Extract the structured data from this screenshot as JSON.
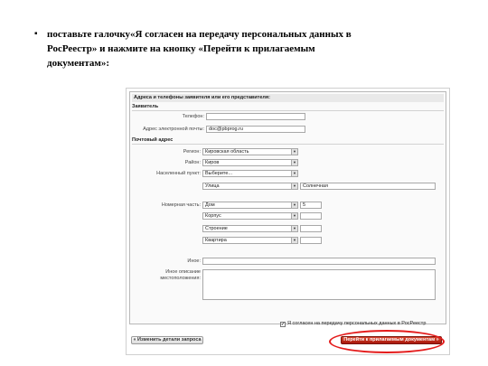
{
  "instruction": {
    "bullet": "▪",
    "text": "поставьте галочку«Я согласен на передачу персональных данных в РосРеестр» и нажмите на кнопку «Перейти к прилагаемым документам»:"
  },
  "form": {
    "panel_title": "Адреса и телефоны заявителя или его представителя:",
    "applicant_section": "Заявитель",
    "phone_label": "Телефон:",
    "phone_value": "",
    "email_label": "Адрес электронной почты:",
    "email_value": "doc@pbprog.ru",
    "postal_section": "Почтовый адрес",
    "region_label": "Регион:",
    "region_value": "Кировская область",
    "district_label": "Район:",
    "district_value": "Киров",
    "locality_label": "Населенный пункт:",
    "locality_value": "Выберите...",
    "street_type_value": "Улица",
    "street_name_value": "Солнечная",
    "number_label": "Номерная часть:",
    "number_rows": [
      {
        "type": "Дом",
        "value": "5"
      },
      {
        "type": "Корпус",
        "value": ""
      },
      {
        "type": "Строение",
        "value": ""
      },
      {
        "type": "Квартира",
        "value": ""
      }
    ],
    "other_label": "Иное:",
    "other_value": "",
    "location_label": "Иное описание местоположения:",
    "location_value": "",
    "consent_label": "Я согласен на передачу персональных данных в РосРеестр",
    "consent_checked": "✔",
    "back_button": "« Изменить детали запроса",
    "next_button": "Перейти к прилагаемым документам »"
  },
  "colors": {
    "highlight": "#e41b1b",
    "primary_button": "#a8180c"
  }
}
